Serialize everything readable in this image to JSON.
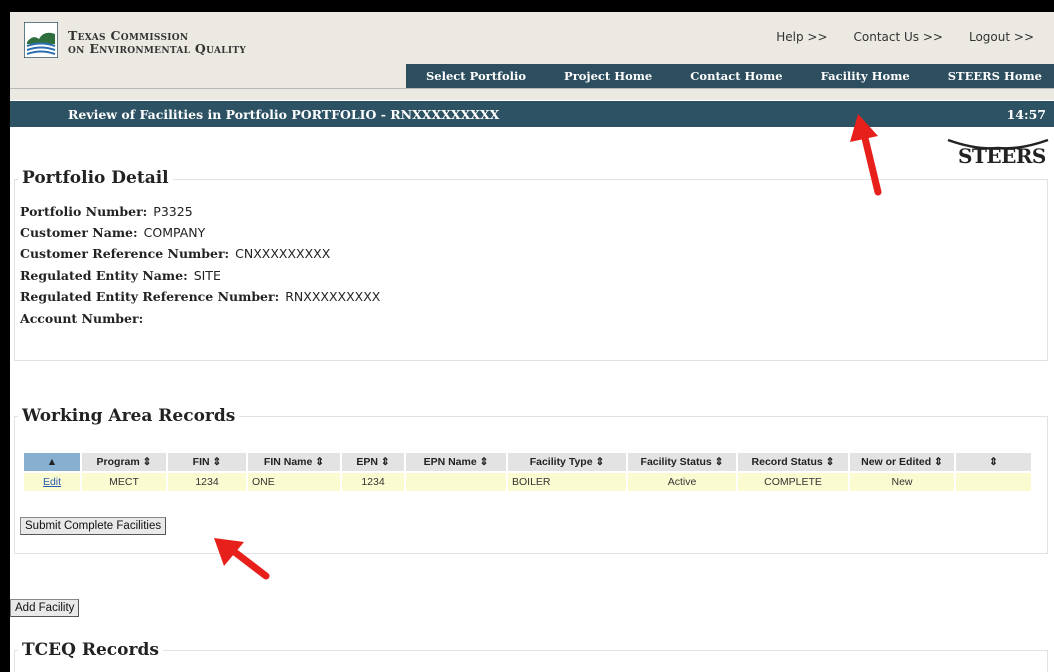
{
  "header": {
    "org_line1": "Texas Commission",
    "org_line2": "on Environmental Quality",
    "util_links": [
      "Help >>",
      "Contact Us >>",
      "Logout >>"
    ],
    "nav": [
      "Select Portfolio",
      "Project Home",
      "Contact Home",
      "Facility Home",
      "STEERS Home"
    ]
  },
  "titlebar": {
    "title": "Review of Facilities in Portfolio PORTFOLIO - RNXXXXXXXXX",
    "clock": "14:57"
  },
  "brand": {
    "steers": "STEERS"
  },
  "portfolio_detail": {
    "legend": "Portfolio Detail",
    "fields": [
      {
        "label": "Portfolio Number:",
        "value": "P3325"
      },
      {
        "label": "Customer Name:",
        "value": "COMPANY"
      },
      {
        "label": "Customer Reference Number:",
        "value": "CNXXXXXXXXX"
      },
      {
        "label": "Regulated Entity Name:",
        "value": "SITE"
      },
      {
        "label": "Regulated Entity Reference Number:",
        "value": "RNXXXXXXXXX"
      },
      {
        "label": "Account Number:",
        "value": ""
      }
    ]
  },
  "working_area": {
    "legend": "Working Area Records",
    "columns": [
      "▲",
      "Program ⇕",
      "FIN ⇕",
      "FIN Name ⇕",
      "EPN ⇕",
      "EPN Name ⇕",
      "Facility Type ⇕",
      "Facility Status ⇕",
      "Record Status ⇕",
      "New or Edited ⇕",
      "⇕"
    ],
    "rows": [
      {
        "edit": "Edit",
        "program": "MECT",
        "fin": "1234",
        "fin_name": "ONE",
        "epn": "1234",
        "epn_name": "",
        "facility_type": "BOILER",
        "facility_status": "Active",
        "record_status": "COMPLETE",
        "new_or_edited": "New",
        "extra": ""
      }
    ],
    "submit_label": "Submit Complete Facilities"
  },
  "add_facility_label": "Add Facility",
  "tceq_records": {
    "legend": "TCEQ Records"
  },
  "colors": {
    "nav_bg": "#2d4e5e",
    "titlebar_bg": "#2c5263",
    "row_bg": "#fbfbd1",
    "sel_header": "#86afd0",
    "arrow": "#e8201c"
  }
}
